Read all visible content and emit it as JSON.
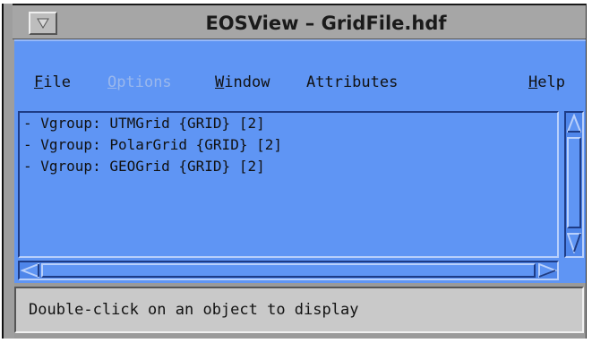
{
  "window": {
    "title": "EOSView – GridFile.hdf",
    "menu_button_icon": "window-menu-down-arrow"
  },
  "menubar": {
    "items": [
      {
        "label_mnemonic": "F",
        "label_rest": "ile",
        "enabled": true
      },
      {
        "label_mnemonic": "O",
        "label_rest": "ptions",
        "enabled": false
      },
      {
        "label_mnemonic": "W",
        "label_rest": "indow",
        "enabled": true
      },
      {
        "label_mnemonic": "",
        "label_rest": "Attributes",
        "enabled": true
      },
      {
        "label_mnemonic": "H",
        "label_rest": "elp",
        "enabled": true
      }
    ]
  },
  "tree_list": {
    "rows": [
      "- Vgroup: UTMGrid {GRID} [2]",
      "- Vgroup: PolarGrid {GRID} [2]",
      "- Vgroup: GEOGrid {GRID} [2]"
    ]
  },
  "scrollbars": {
    "vertical": {
      "up_icon": "scroll-up-arrow",
      "down_icon": "scroll-down-arrow"
    },
    "horizontal": {
      "left_icon": "scroll-left-arrow",
      "right_icon": "scroll-right-arrow"
    }
  },
  "status": {
    "message": "Double-click on an object to display"
  },
  "colors": {
    "panel_blue": "#5f95f4",
    "frame_gray": "#9a9a9a",
    "status_gray": "#c9c9c9"
  }
}
